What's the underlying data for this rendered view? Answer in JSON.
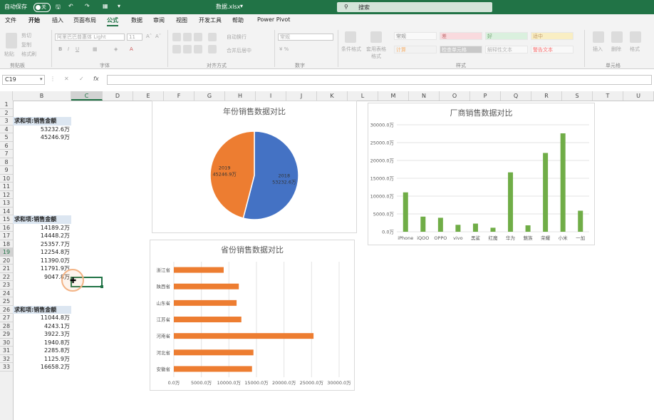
{
  "titlebar": {
    "autosave_label": "自动保存",
    "autosave_state": "关",
    "filename": "数据.xlsx",
    "search_placeholder": "搜索"
  },
  "tabs": [
    "文件",
    "开始",
    "插入",
    "页面布局",
    "公式",
    "数据",
    "审阅",
    "视图",
    "开发工具",
    "帮助",
    "Power Pivot"
  ],
  "active_tab": "公式",
  "ribbon": {
    "cut": "剪切",
    "copy": "复制",
    "format_painter": "格式刷",
    "paste": "粘贴",
    "font_name": "阿里巴巴普惠体 Light",
    "font_size": "11",
    "wrap_text": "自动换行",
    "merge_center": "合并后居中",
    "number_format": "常规",
    "cond_format": "条件格式",
    "table_format": "套用表格格式",
    "styles": [
      {
        "label": "常规",
        "bg": "#ffffff",
        "fg": "#333333"
      },
      {
        "label": "差",
        "bg": "#ffc7ce",
        "fg": "#9c0006"
      },
      {
        "label": "好",
        "bg": "#c6efce",
        "fg": "#006100"
      },
      {
        "label": "适中",
        "bg": "#ffeb9c",
        "fg": "#9c5700"
      },
      {
        "label": "计算",
        "bg": "#f2f2f2",
        "fg": "#fa7d00"
      },
      {
        "label": "检查单元格",
        "bg": "#a5a5a5",
        "fg": "#ffffff"
      },
      {
        "label": "解释性文本",
        "bg": "#ffffff",
        "fg": "#7f7f7f"
      },
      {
        "label": "警告文本",
        "bg": "#ffffff",
        "fg": "#ff0000"
      }
    ],
    "insert": "插入",
    "delete": "删除",
    "format": "格式",
    "groups": [
      "剪贴板",
      "字体",
      "对齐方式",
      "数字",
      "样式",
      "单元格"
    ]
  },
  "formula_bar": {
    "name_box": "C19",
    "fx": "fx",
    "cancel": "✕",
    "confirm": "✓"
  },
  "columns": [
    "B",
    "C",
    "D",
    "E",
    "F",
    "G",
    "H",
    "I",
    "J",
    "K",
    "L",
    "M",
    "N",
    "O",
    "P",
    "Q",
    "R",
    "S",
    "T",
    "U"
  ],
  "selected_column": "C",
  "rows": [
    "1",
    "2",
    "3",
    "4",
    "5",
    "6",
    "7",
    "8",
    "9",
    "10",
    "11",
    "12",
    "13",
    "14",
    "15",
    "16",
    "17",
    "18",
    "19",
    "20",
    "21",
    "22",
    "23",
    "24",
    "25",
    "26",
    "27",
    "28",
    "29",
    "30",
    "31",
    "32",
    "33"
  ],
  "selected_row": "19",
  "pivot_header": "求和项:销售金额",
  "cells_year": [
    "53232.6万",
    "45246.9万"
  ],
  "cells_province": [
    "14189.2万",
    "14448.2万",
    "25357.7万",
    "12254.8万",
    "11390.0万",
    "11791.9万",
    "9047.8万"
  ],
  "cells_vendor": [
    "11044.8万",
    "4243.1万",
    "3922.3万",
    "1940.8万",
    "2285.8万",
    "1125.9万",
    "16658.2万"
  ],
  "charts": {
    "pie": {
      "type": "pie",
      "title": "年份销售数据对比",
      "slices": [
        {
          "label": "2018",
          "value_label": "53232.6万",
          "value": 53232.6,
          "color": "#4472c4"
        },
        {
          "label": "2019",
          "value_label": "45246.9万",
          "value": 45246.9,
          "color": "#ed7d31"
        }
      ]
    },
    "vendor": {
      "type": "bar",
      "title": "厂商销售数据对比",
      "color": "#70ad47",
      "categories": [
        "iPhone",
        "iQOO",
        "OPPO",
        "vivo",
        "黑鲨",
        "红魔",
        "华为",
        "魅族",
        "荣耀",
        "小米",
        "一加"
      ],
      "values": [
        11044.8,
        4243.1,
        3922.3,
        1940.8,
        2285.8,
        1125.9,
        16658.2,
        1800,
        22100,
        27600,
        5900
      ],
      "ylim": [
        0,
        30000
      ],
      "y_ticks": [
        "0.0万",
        "5000.0万",
        "10000.0万",
        "15000.0万",
        "20000.0万",
        "25000.0万",
        "30000.0万"
      ]
    },
    "province": {
      "type": "bar",
      "title": "省份销售数据对比",
      "color": "#ed7d31",
      "categories": [
        "浙江省",
        "陕西省",
        "山东省",
        "江苏省",
        "河南省",
        "河北省",
        "安徽省"
      ],
      "values": [
        9047.8,
        11791.9,
        11390.0,
        12254.8,
        25357.7,
        14448.2,
        14189.2
      ],
      "xlim": [
        0,
        30000
      ],
      "x_ticks": [
        "0.0万",
        "5000.0万",
        "10000.0万",
        "15000.0万",
        "20000.0万",
        "25000.0万",
        "30000.0万"
      ]
    }
  }
}
